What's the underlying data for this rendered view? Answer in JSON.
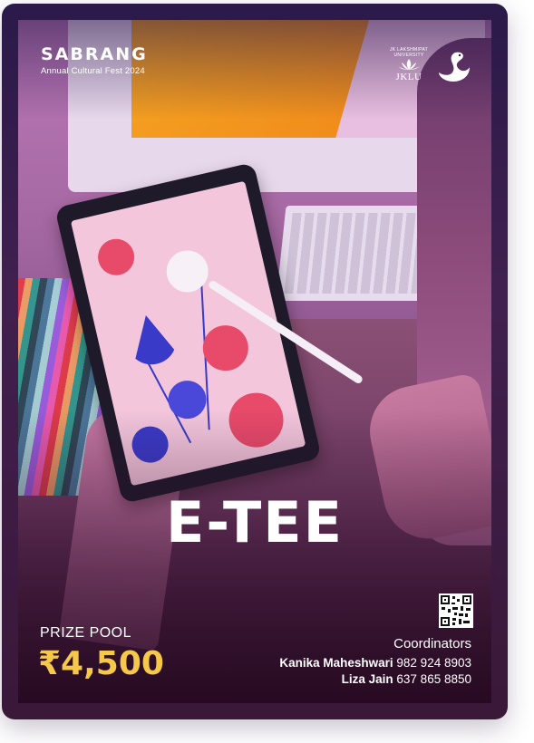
{
  "brand": {
    "name": "SABRANG",
    "subtitle": "Annual Cultural Fest 2024"
  },
  "university": {
    "name": "JKLU",
    "arc_text": "JK LAKSHMIPAT UNIVERSITY"
  },
  "event": {
    "title": "E-TEE"
  },
  "prize": {
    "label": "PRIZE POOL",
    "amount": "₹4,500"
  },
  "coordinators": {
    "title": "Coordinators",
    "people": [
      {
        "name": "Kanika Maheshwari",
        "phone": "982 924 8903"
      },
      {
        "name": "Liza Jain",
        "phone": "637 865 8850"
      }
    ]
  },
  "icons": {
    "university_logo": "lotus-icon",
    "swan_logo": "swan-icon",
    "qr_code": "qr-code-icon"
  },
  "colors": {
    "accent": "#f6c84a",
    "text": "#ffffff",
    "frame": "#2a1a4a"
  }
}
